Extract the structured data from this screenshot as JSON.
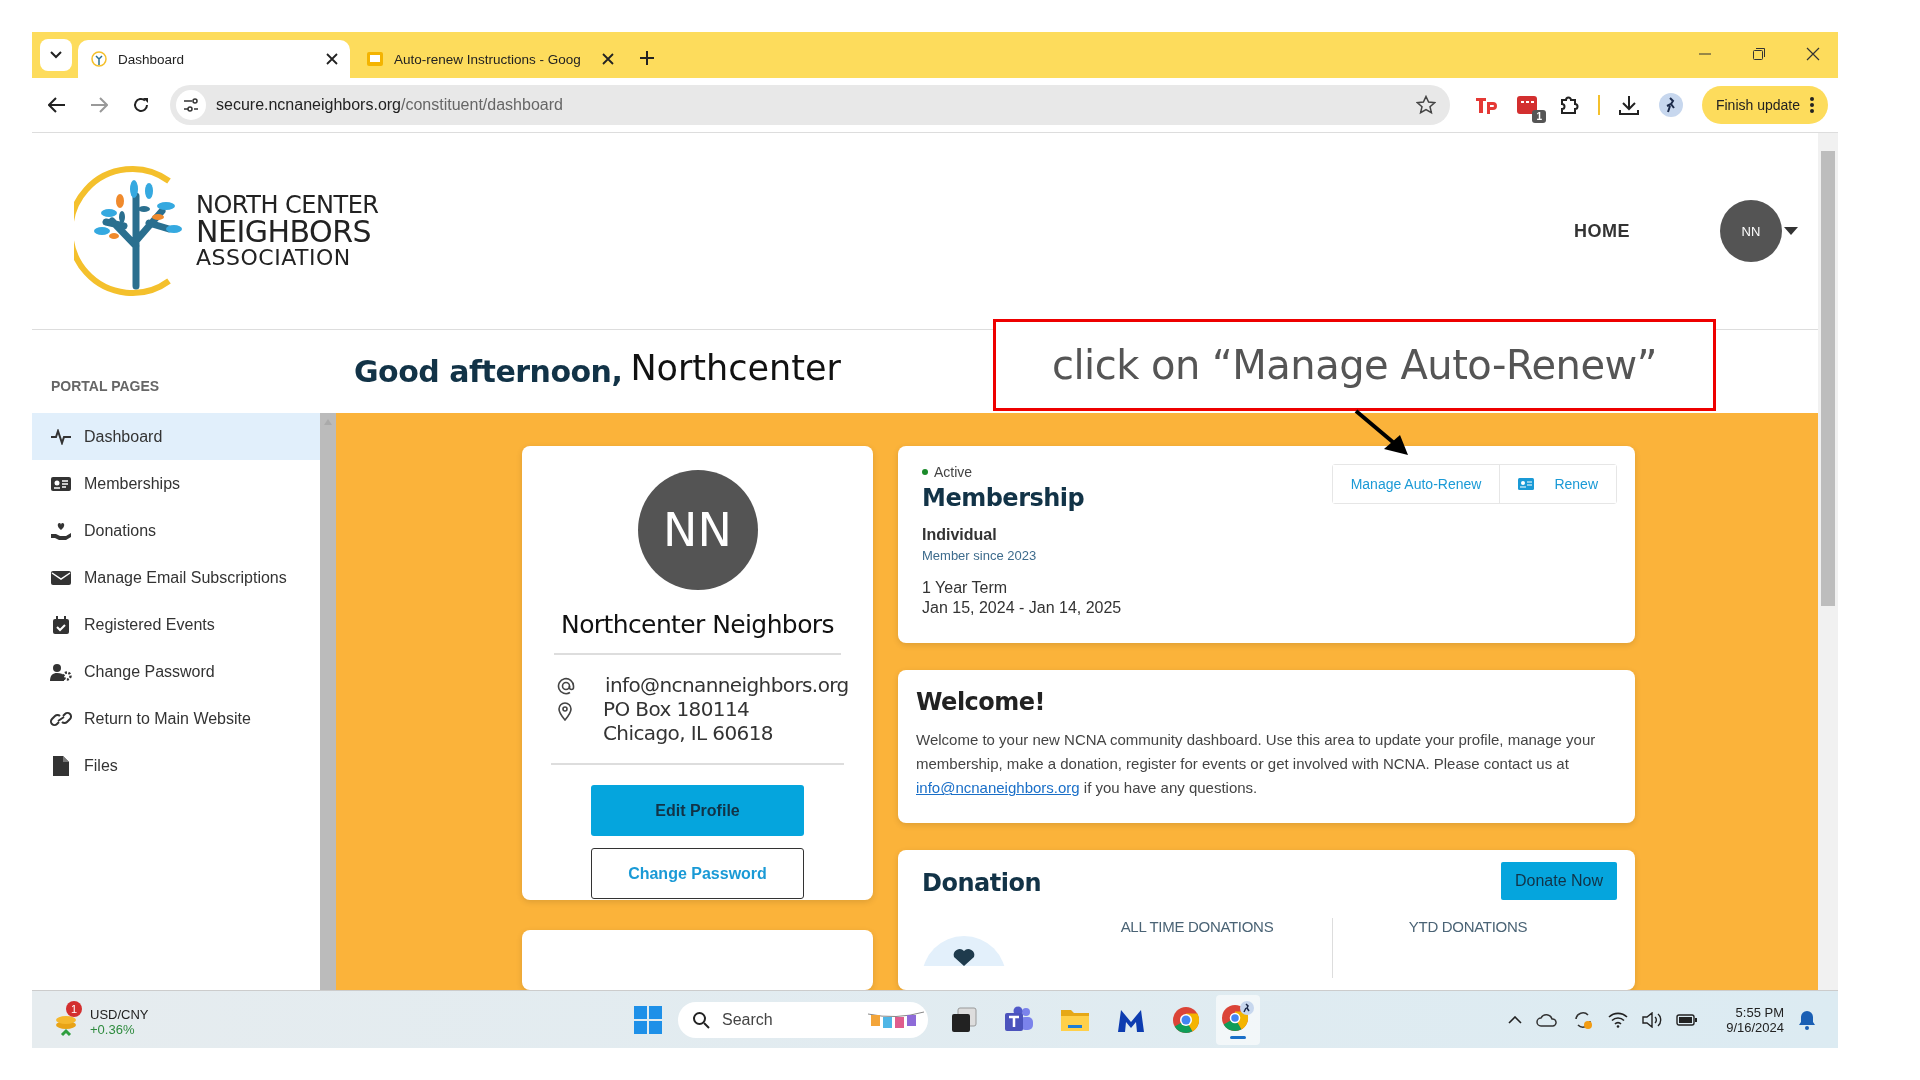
{
  "browser": {
    "tabs": [
      {
        "title": "Dashboard",
        "selected": true
      },
      {
        "title": "Auto-renew Instructions - Goog",
        "selected": false
      }
    ],
    "url": {
      "host": "secure.ncnaneighbors.org",
      "path": "/constituent/dashboard"
    },
    "extension_badge": "1",
    "update_button": "Finish update"
  },
  "header": {
    "logo_lines": [
      "NORTH CENTER",
      "NEIGHBORS",
      "ASSOCIATION"
    ],
    "nav": "HOME",
    "avatar": "NN"
  },
  "greeting": "Good afternoon,",
  "annotation": {
    "overlay": "Northcenter",
    "callout": "click on “Manage Auto-Renew”"
  },
  "sidebar": {
    "heading": "PORTAL PAGES",
    "items": [
      {
        "label": "Dashboard",
        "selected": true
      },
      {
        "label": "Memberships",
        "selected": false
      },
      {
        "label": "Donations",
        "selected": false
      },
      {
        "label": "Manage Email Subscriptions",
        "selected": false
      },
      {
        "label": "Registered Events",
        "selected": false
      },
      {
        "label": "Change Password",
        "selected": false
      },
      {
        "label": "Return to Main Website",
        "selected": false
      },
      {
        "label": "Files",
        "selected": false
      }
    ]
  },
  "profile": {
    "initials": "NN",
    "name": "Northcenter Neighbors",
    "email": "info@ncnanneighbors.org",
    "address": [
      "PO Box 180114",
      "Chicago, IL 60618"
    ],
    "buttons": [
      "Edit Profile",
      "Change Password"
    ]
  },
  "membership": {
    "status": "Active",
    "title": "Membership",
    "type": "Individual",
    "since": "Member since 2023",
    "term": "1 Year Term",
    "dates": "Jan 15, 2024 - Jan 14, 2025",
    "buttons": [
      "Manage Auto-Renew",
      "Renew"
    ]
  },
  "welcome": {
    "title": "Welcome!",
    "text_before": "Welcome to your new NCNA community dashboard. Use this area to update your profile, manage your membership, make a donation, register for events or get involved with NCNA. Please contact us at ",
    "link": "info@ncnaneighbors.org",
    "text_after": " if you have any questions."
  },
  "donation": {
    "title": "Donation",
    "button": "Donate Now",
    "stats": [
      "ALL TIME DONATIONS",
      "YTD DONATIONS"
    ]
  },
  "taskbar": {
    "widget": {
      "badge": "1",
      "label": "USD/CNY",
      "change": "+0.36%"
    },
    "search": "Search",
    "time": "5:55 PM",
    "date": "9/16/2024"
  }
}
